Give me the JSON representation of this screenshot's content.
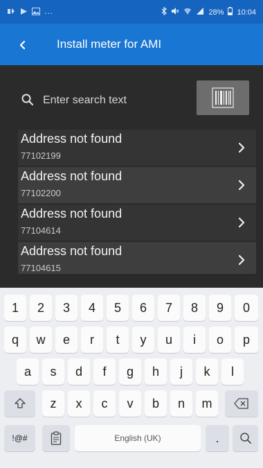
{
  "status_bar": {
    "dots": "...",
    "battery": "28%",
    "time": "10:04",
    "icons": [
      "notification-icon",
      "play-icon",
      "image-icon",
      "bluetooth-icon",
      "mute-icon",
      "wifi-icon",
      "signal-icon",
      "battery-icon"
    ]
  },
  "app_bar": {
    "title": "Install meter for AMI",
    "back_icon": "chevron-left-icon",
    "color": "#1976d2"
  },
  "search": {
    "placeholder": "Enter search text",
    "value": "",
    "icon": "search-icon",
    "scan_icon": "barcode-icon"
  },
  "results": [
    {
      "title": "Address not found",
      "id": "77102199"
    },
    {
      "title": "Address not found",
      "id": "77102200"
    },
    {
      "title": "Address not found",
      "id": "77104614"
    },
    {
      "title": "Address not found",
      "id": "77104615"
    }
  ],
  "keyboard": {
    "row1": [
      "1",
      "2",
      "3",
      "4",
      "5",
      "6",
      "7",
      "8",
      "9",
      "0"
    ],
    "row2": [
      "q",
      "w",
      "e",
      "r",
      "t",
      "y",
      "u",
      "i",
      "o",
      "p"
    ],
    "row3": [
      "a",
      "s",
      "d",
      "f",
      "g",
      "h",
      "j",
      "k",
      "l"
    ],
    "row4": [
      "z",
      "x",
      "c",
      "v",
      "b",
      "n",
      "m"
    ],
    "symbols_label": "!@#",
    "space_label": "English (UK)",
    "period_label": ".",
    "shift_icon": "shift-icon",
    "backspace_icon": "backspace-icon",
    "clipboard_icon": "clipboard-icon",
    "search_key_icon": "search-icon"
  }
}
